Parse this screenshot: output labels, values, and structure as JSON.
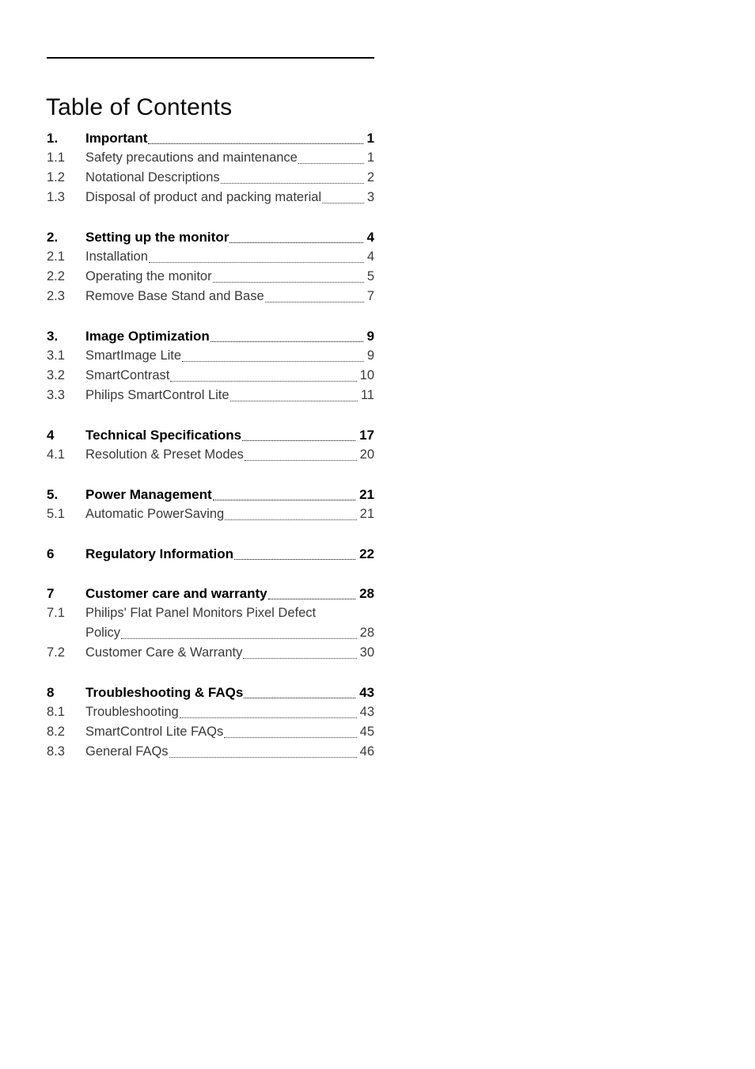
{
  "document": {
    "title": "Table of Contents"
  },
  "toc": {
    "groups": [
      {
        "rows": [
          {
            "num": "1.",
            "label": "Important",
            "page": "1",
            "level": 1,
            "leader": true
          },
          {
            "num": "1.1",
            "label": "Safety precautions and maintenance",
            "page": "1",
            "level": 2,
            "leader": true
          },
          {
            "num": "1.2",
            "label": "Notational Descriptions",
            "page": "2",
            "level": 2,
            "leader": true
          },
          {
            "num": "1.3",
            "label": "Disposal of product and packing material",
            "page": "3",
            "level": 2,
            "leader": true
          }
        ]
      },
      {
        "rows": [
          {
            "num": "2.",
            "label": "Setting up the monitor",
            "page": "4",
            "level": 1,
            "leader": true
          },
          {
            "num": "2.1",
            "label": "Installation",
            "page": "4",
            "level": 2,
            "leader": true
          },
          {
            "num": "2.2",
            "label": "Operating the monitor",
            "page": "5",
            "level": 2,
            "leader": true
          },
          {
            "num": "2.3",
            "label": "Remove Base Stand and Base",
            "page": "7",
            "level": 2,
            "leader": true
          }
        ]
      },
      {
        "rows": [
          {
            "num": "3.",
            "label": "Image Optimization",
            "page": "9",
            "level": 1,
            "leader": true
          },
          {
            "num": "3.1",
            "label": "SmartImage Lite",
            "page": "9",
            "level": 2,
            "leader": true
          },
          {
            "num": "3.2",
            "label": "SmartContrast",
            "page": "10",
            "level": 2,
            "leader": true
          },
          {
            "num": "3.3",
            "label": "Philips SmartControl Lite",
            "page": "11",
            "level": 2,
            "leader": true
          }
        ]
      },
      {
        "rows": [
          {
            "num": "4",
            "label": "Technical Specifications",
            "page": "17",
            "level": 1,
            "leader": true
          },
          {
            "num": "4.1",
            "label": "Resolution & Preset Modes",
            "page": "20",
            "level": 2,
            "leader": true
          }
        ]
      },
      {
        "rows": [
          {
            "num": "5.",
            "label": "Power Management",
            "page": "21",
            "level": 1,
            "leader": true
          },
          {
            "num": "5.1",
            "label": "Automatic PowerSaving",
            "page": "21",
            "level": 2,
            "leader": true
          }
        ]
      },
      {
        "rows": [
          {
            "num": "6",
            "label": "Regulatory Information",
            "page": "22",
            "level": 1,
            "leader": true
          }
        ]
      },
      {
        "rows": [
          {
            "num": "7",
            "label": "Customer care and warranty",
            "page": "28",
            "level": 1,
            "leader": true
          },
          {
            "num": "7.1",
            "label": "Philips' Flat Panel Monitors Pixel Defect",
            "page": "",
            "level": 2,
            "leader": false
          },
          {
            "num": "",
            "label": "Policy",
            "page": "28",
            "level": 2,
            "leader": true,
            "continuation": true
          },
          {
            "num": "7.2",
            "label": "Customer Care & Warranty",
            "page": "30",
            "level": 2,
            "leader": true
          }
        ]
      },
      {
        "rows": [
          {
            "num": "8",
            "label": "Troubleshooting & FAQs",
            "page": "43",
            "level": 1,
            "leader": true
          },
          {
            "num": "8.1",
            "label": "Troubleshooting",
            "page": "43",
            "level": 2,
            "leader": true
          },
          {
            "num": "8.2",
            "label": "SmartControl Lite FAQs",
            "page": "45",
            "level": 2,
            "leader": true
          },
          {
            "num": "8.3",
            "label": "General FAQs",
            "page": "46",
            "level": 2,
            "leader": true
          }
        ]
      }
    ]
  }
}
